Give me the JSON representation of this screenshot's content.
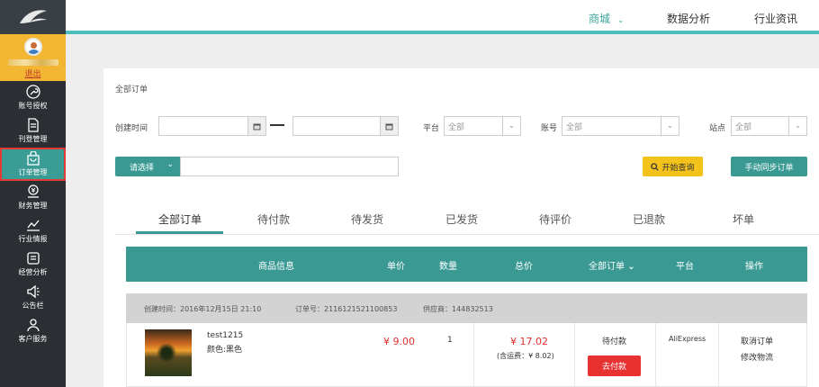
{
  "sidebar": {
    "logout": "退出",
    "items": [
      {
        "label": "账号授权",
        "icon": "wrench-icon"
      },
      {
        "label": "刊登管理",
        "icon": "document-icon"
      },
      {
        "label": "订单管理",
        "icon": "shopping-bag-icon"
      },
      {
        "label": "财务管理",
        "icon": "money-icon"
      },
      {
        "label": "行业情报",
        "icon": "trend-chart-icon"
      },
      {
        "label": "经营分析",
        "icon": "list-icon"
      },
      {
        "label": "公告栏",
        "icon": "megaphone-icon"
      },
      {
        "label": "客户服务",
        "icon": "people-icon"
      }
    ],
    "active_index": 2
  },
  "topnav": {
    "mall": "商城",
    "data_analysis": "数据分析",
    "industry_news": "行业资讯"
  },
  "breadcrumb": "全部订单",
  "filters": {
    "created_time_label": "创建时间",
    "platform_label": "平台",
    "platform_value": "全部",
    "account_label": "账号",
    "account_value": "全部",
    "site_label": "站点",
    "site_value": "全部",
    "search_select": "请选择",
    "start_query": "开始查询",
    "manual_sync": "手动同步订单"
  },
  "tabs": [
    "全部订单",
    "待付款",
    "待发货",
    "已发货",
    "待评价",
    "已退款",
    "坏单"
  ],
  "table": {
    "headers": {
      "product": "商品信息",
      "price": "单价",
      "quantity": "数量",
      "total": "总价",
      "status_filter": "全部订单",
      "platform": "平台",
      "action": "操作"
    }
  },
  "order": {
    "created": "创建时间：2016年12月15日 21:10",
    "order_no": "订单号：2116121521100853",
    "supplier": "供应商：144832513",
    "product_name": "test1215",
    "product_color": "颜色:黑色",
    "price": "¥ 9.00",
    "quantity": "1",
    "total": "¥ 17.02",
    "shipping_note": "(含运费：¥ 8.02)",
    "status": "待付款",
    "pay_button": "去付款",
    "platform": "AliExpress",
    "cancel": "取消订单",
    "modify_logistics": "修改物流"
  },
  "colors": {
    "teal": "#3a9a93",
    "yellow": "#f3c21b",
    "red": "#e83232",
    "sidebar": "#2b2e33"
  }
}
